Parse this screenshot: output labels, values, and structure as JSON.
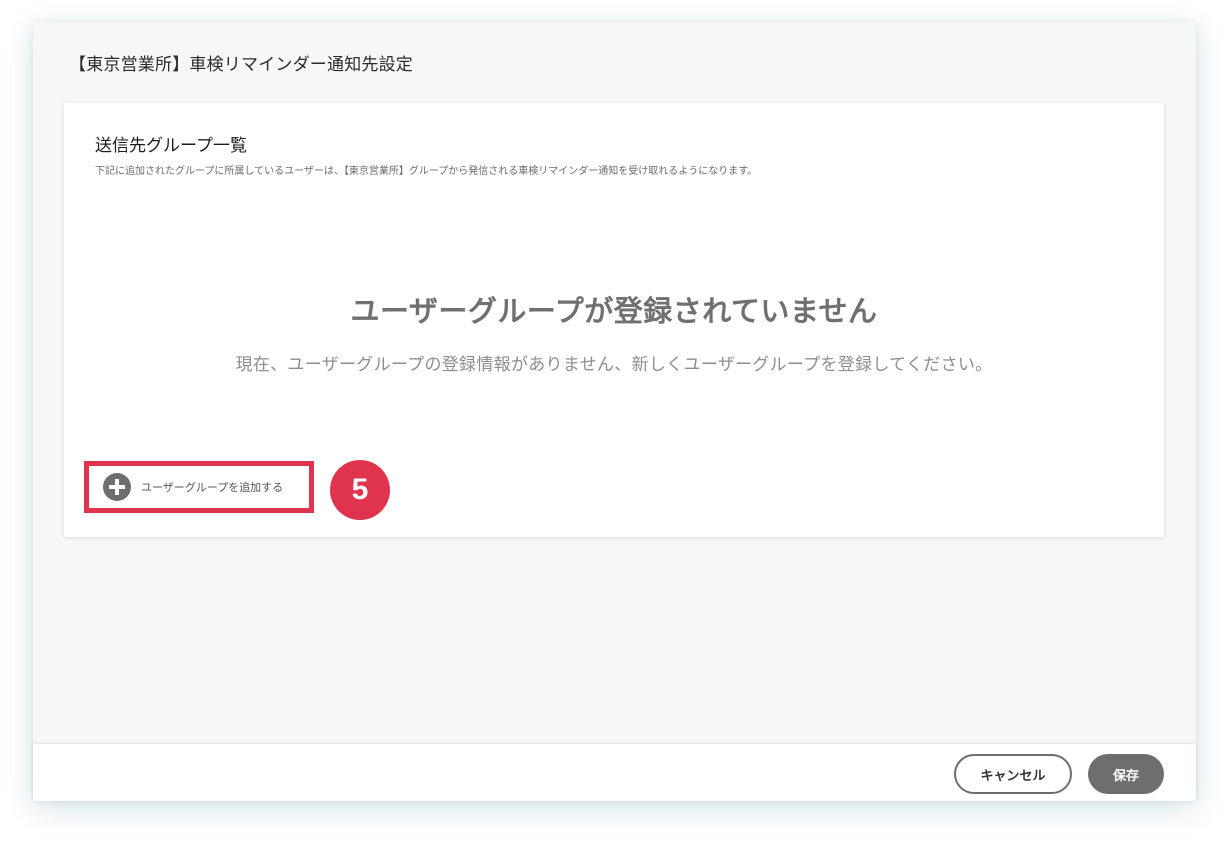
{
  "window": {
    "title": "【東京営業所】車検リマインダー通知先設定"
  },
  "section": {
    "title": "送信先グループ一覧",
    "description": "下記に追加されたグループに所属しているユーザーは、【東京営業所】グループから発信される車検リマインダー通知を受け取れるようになります。"
  },
  "empty_state": {
    "heading": "ユーザーグループが登録されていません",
    "message": "現在、ユーザーグループの登録情報がありません、新しくユーザーグループを登録してください。"
  },
  "add_group_button": {
    "label": "ユーザーグループを追加する",
    "icon": "plus-circle-icon"
  },
  "step_badge": {
    "number": "5"
  },
  "footer": {
    "cancel_label": "キャンセル",
    "save_label": "保存"
  },
  "colors": {
    "highlight": "#e0334d",
    "button_gray": "#6e6e6e",
    "background": "#f7f7f7"
  }
}
